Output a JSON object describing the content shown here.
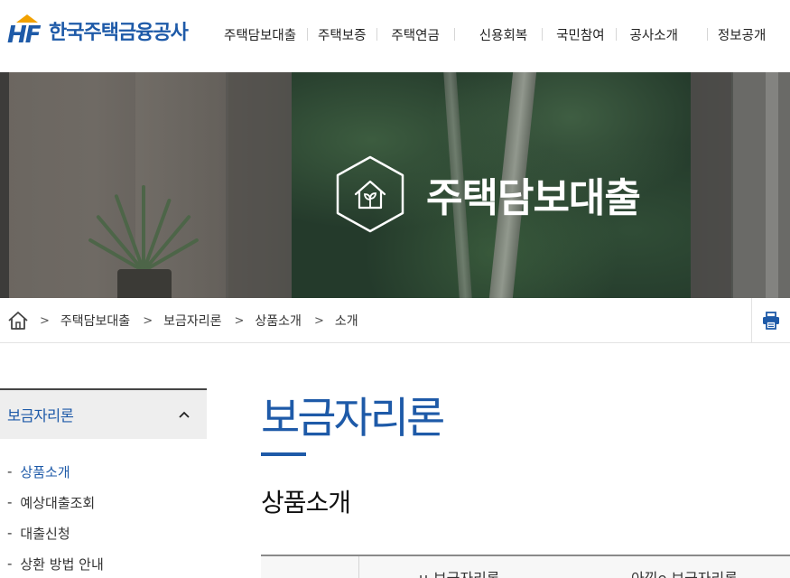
{
  "header": {
    "logo_text": "한국주택금융공사",
    "nav": [
      "주택담보대출",
      "주택보증",
      "주택연금",
      "신용회복",
      "국민참여",
      "공사소개",
      "정보공개"
    ]
  },
  "hero": {
    "title": "주택담보대출"
  },
  "breadcrumb": {
    "items": [
      "주택담보대출",
      "보금자리론",
      "상품소개",
      "소개"
    ]
  },
  "sidebar": {
    "heading": "보금자리론",
    "items": [
      {
        "label": "상품소개",
        "active": true
      },
      {
        "label": "예상대출조회",
        "active": false
      },
      {
        "label": "대출신청",
        "active": false
      },
      {
        "label": "상환 방법 안내",
        "active": false
      }
    ]
  },
  "main": {
    "title": "보금자리론",
    "subtitle": "상품소개",
    "table_headers": [
      "u-보금자리론",
      "아낌e 보금자리론"
    ]
  },
  "colors": {
    "brand_blue": "#1e5aa8",
    "logo_orange": "#f2a100"
  }
}
